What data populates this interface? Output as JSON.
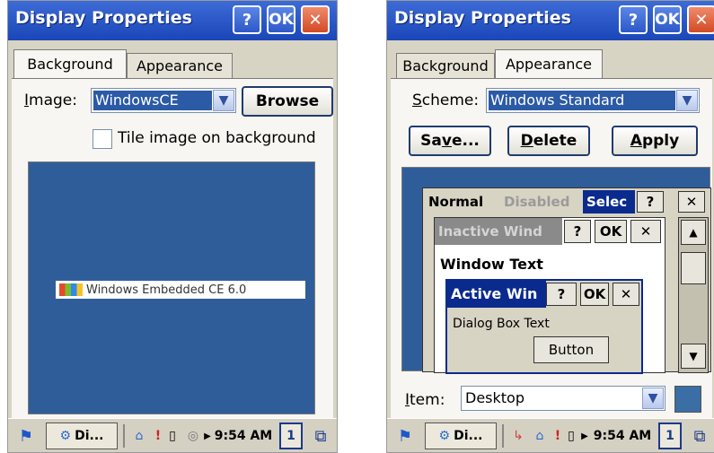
{
  "left": {
    "title": "Display Properties",
    "help_label": "?",
    "ok_label": "OK",
    "close_label": "✕",
    "tabs": [
      {
        "label": "Background"
      },
      {
        "label": "Appearance"
      }
    ],
    "image_label_first": "I",
    "image_label_rest": "mage:",
    "image_value": "WindowsCE",
    "browse_label": "Browse",
    "tile_label": "Tile image on background",
    "logo_text": "Windows Embedded CE 6.0",
    "taskbar": {
      "app_label": "Di...",
      "time": "9:54 AM",
      "desktop_num": "1"
    }
  },
  "right": {
    "title": "Display Properties",
    "help_label": "?",
    "ok_label": "OK",
    "close_label": "✕",
    "tabs": [
      {
        "label": "Background"
      },
      {
        "label": "Appearance"
      }
    ],
    "scheme_label_first": "S",
    "scheme_label_rest": "cheme:",
    "scheme_value": "Windows Standard",
    "save_label_a": "Sa",
    "save_label_b": "v",
    "save_label_c": "e...",
    "delete_label_a": "D",
    "delete_label_b": "elete",
    "apply_label_a": "A",
    "apply_label_b": "pply",
    "preview": {
      "normal": "Normal",
      "disabled": "Disabled",
      "selected": "Selec",
      "q": "?",
      "x": "✕",
      "inactive_title": "Inactive Wind",
      "ok": "OK",
      "window_text": "Window Text",
      "active_title": "Active Win",
      "dialog_text": "Dialog Box Text",
      "button": "Button"
    },
    "item_label_first": "I",
    "item_label_rest": "tem:",
    "item_value": "Desktop",
    "item_color": "#3a6ea5",
    "taskbar": {
      "app_label": "Di...",
      "time": "9:54 AM",
      "desktop_num": "1"
    }
  }
}
